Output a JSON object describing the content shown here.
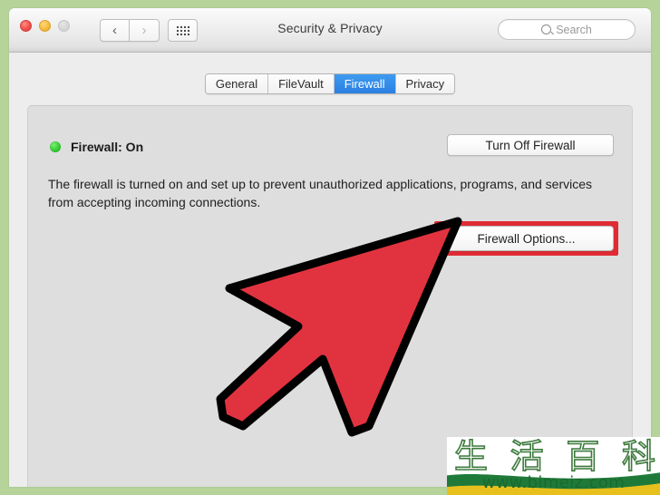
{
  "window": {
    "title": "Security & Privacy",
    "traffic_lights": [
      "close-button",
      "minimize-button",
      "zoom-button"
    ],
    "nav": {
      "back_glyph": "‹",
      "forward_glyph": "›",
      "grid_label": "show-all-button"
    },
    "search": {
      "placeholder": "Search",
      "value": ""
    }
  },
  "tabs": [
    {
      "label": "General",
      "active": false
    },
    {
      "label": "FileVault",
      "active": false
    },
    {
      "label": "Firewall",
      "active": true
    },
    {
      "label": "Privacy",
      "active": false
    }
  ],
  "firewall": {
    "status_label": "Firewall: On",
    "status_color": "#33cc33",
    "turn_off_label": "Turn Off Firewall",
    "description": "The firewall is turned on and set up to prevent unauthorized applications, programs, and services from accepting incoming connections.",
    "options_label": "Firewall Options...",
    "highlight_color": "#e02b34"
  },
  "annotation": {
    "pointer_fill": "#e1333f",
    "pointer_stroke": "#000000"
  },
  "watermark": {
    "chars": [
      "生",
      "活",
      "百",
      "科"
    ],
    "url": "www.bimeiz.com",
    "stroke_color": "#3d7a3d",
    "url_color": "#1a6a2e"
  },
  "frame": {
    "border_color": "#b6d39a"
  }
}
